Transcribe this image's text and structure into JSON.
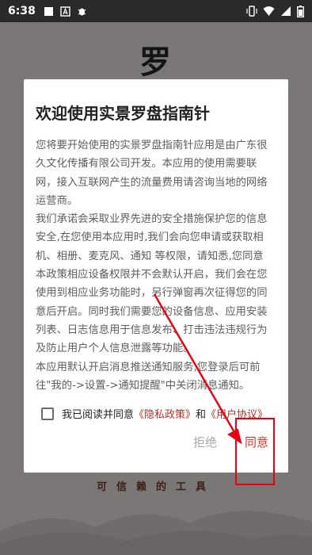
{
  "status_bar": {
    "time": "6:38",
    "left_icons": [
      "square-icon",
      "a-badge-icon",
      "bug-icon"
    ],
    "right_icons": [
      "vibrate-icon",
      "wifi-icon",
      "signal-icon",
      "battery-icon"
    ]
  },
  "background": {
    "logo_glyph": "罗",
    "tagline": "可信赖的工具"
  },
  "dialog": {
    "title": "欢迎使用实景罗盘指南针",
    "paragraphs": [
      "您将要开始使用的实景罗盘指南针应用是由广东很久文化传播有限公司开发。本应用的使用需要联网，接入互联网产生的流量费用请咨询当地的网络运营商。",
      "我们承诺会采取业界先进的安全措施保护您的信息安全,在您使用本应用时,我们会向您申请或获取相机、相册、麦克风、通知 等权限，请知悉,您同意本政策相应设备权限并不会默认开启，我们会在您使用到相应业务功能时，另行弹窗再次征得您的同意后开启。同时我们需要您的设备信息、应用安装列表、日志信息用于信息发布、打击违法违规行为及防止用户个人信息泄露等功能。",
      "本应用默认开启消息推送通知服务,您登录后可前往\"我的->设置->通知提醒\"中关闭消息通知。"
    ],
    "agree_prefix": "我已阅读并同意",
    "privacy_link": "《隐私政策》",
    "and_text": "和",
    "user_agreement_link": "《用户协议》",
    "checkbox_checked": false,
    "decline_label": "拒绝",
    "agree_label": "同意"
  },
  "colors": {
    "accent": "#c4392d",
    "annotation": "#e60012"
  }
}
